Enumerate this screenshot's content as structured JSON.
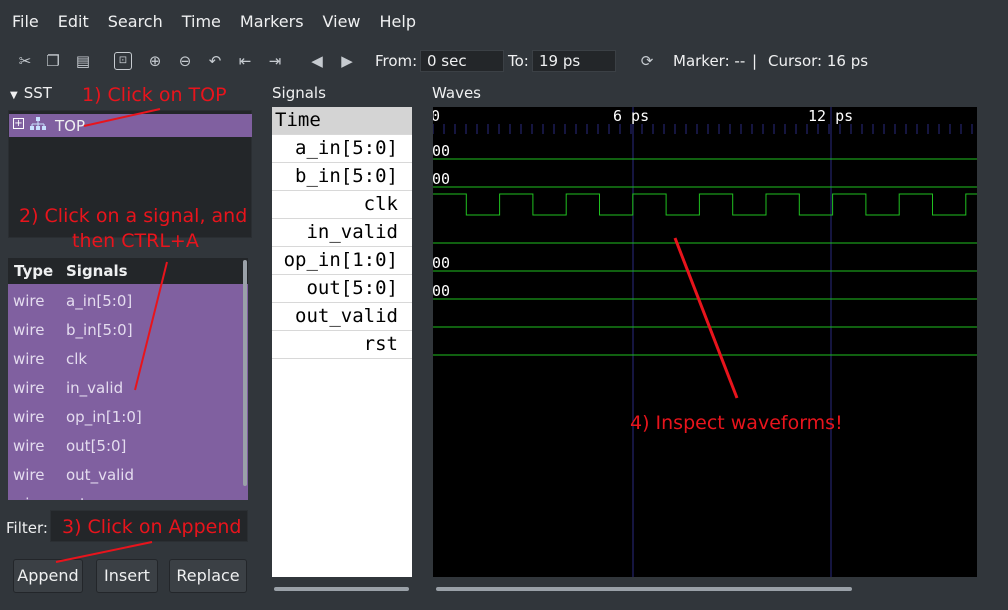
{
  "menu": [
    "File",
    "Edit",
    "Search",
    "Time",
    "Markers",
    "View",
    "Help"
  ],
  "toolbar": {
    "from_label": "From:",
    "from_value": "0 sec",
    "to_label": "To:",
    "to_value": "19 ps",
    "marker": "Marker: --",
    "separator": "|",
    "cursor": "Cursor: 16 ps"
  },
  "sst": {
    "title": "SST",
    "tree_item": "TOP"
  },
  "signal_list": {
    "col_type": "Type",
    "col_signals": "Signals",
    "rows": [
      {
        "type": "wire",
        "name": "a_in[5:0]"
      },
      {
        "type": "wire",
        "name": "b_in[5:0]"
      },
      {
        "type": "wire",
        "name": "clk"
      },
      {
        "type": "wire",
        "name": "in_valid"
      },
      {
        "type": "wire",
        "name": "op_in[1:0]"
      },
      {
        "type": "wire",
        "name": "out[5:0]"
      },
      {
        "type": "wire",
        "name": "out_valid"
      },
      {
        "type": "wire",
        "name": "rst"
      }
    ]
  },
  "filter": {
    "label": "Filter:"
  },
  "buttons": {
    "append": "Append",
    "insert": "Insert",
    "replace": "Replace"
  },
  "signals_pane": {
    "title": "Signals",
    "time": "Time",
    "names": [
      "a_in[5:0]",
      "b_in[5:0]",
      "clk",
      "in_valid",
      "op_in[1:0]",
      "out[5:0]",
      "out_valid",
      "rst"
    ]
  },
  "waves": {
    "title": "Waves",
    "tick_labels": [
      "0",
      "6 ps",
      "12 ps"
    ],
    "values": {
      "a_in": "00",
      "b_in": "00",
      "op_in": "00",
      "out": "00"
    },
    "trace_color": "#20c020",
    "grid_color": "#2a2a80"
  },
  "annotations": {
    "step1": "1) Click on TOP",
    "step2a": "2) Click on a signal, and",
    "step2b": "then CTRL+A",
    "step3": "3) Click on Append",
    "step4": "4) Inspect waveforms!",
    "color": "#e8141c"
  }
}
